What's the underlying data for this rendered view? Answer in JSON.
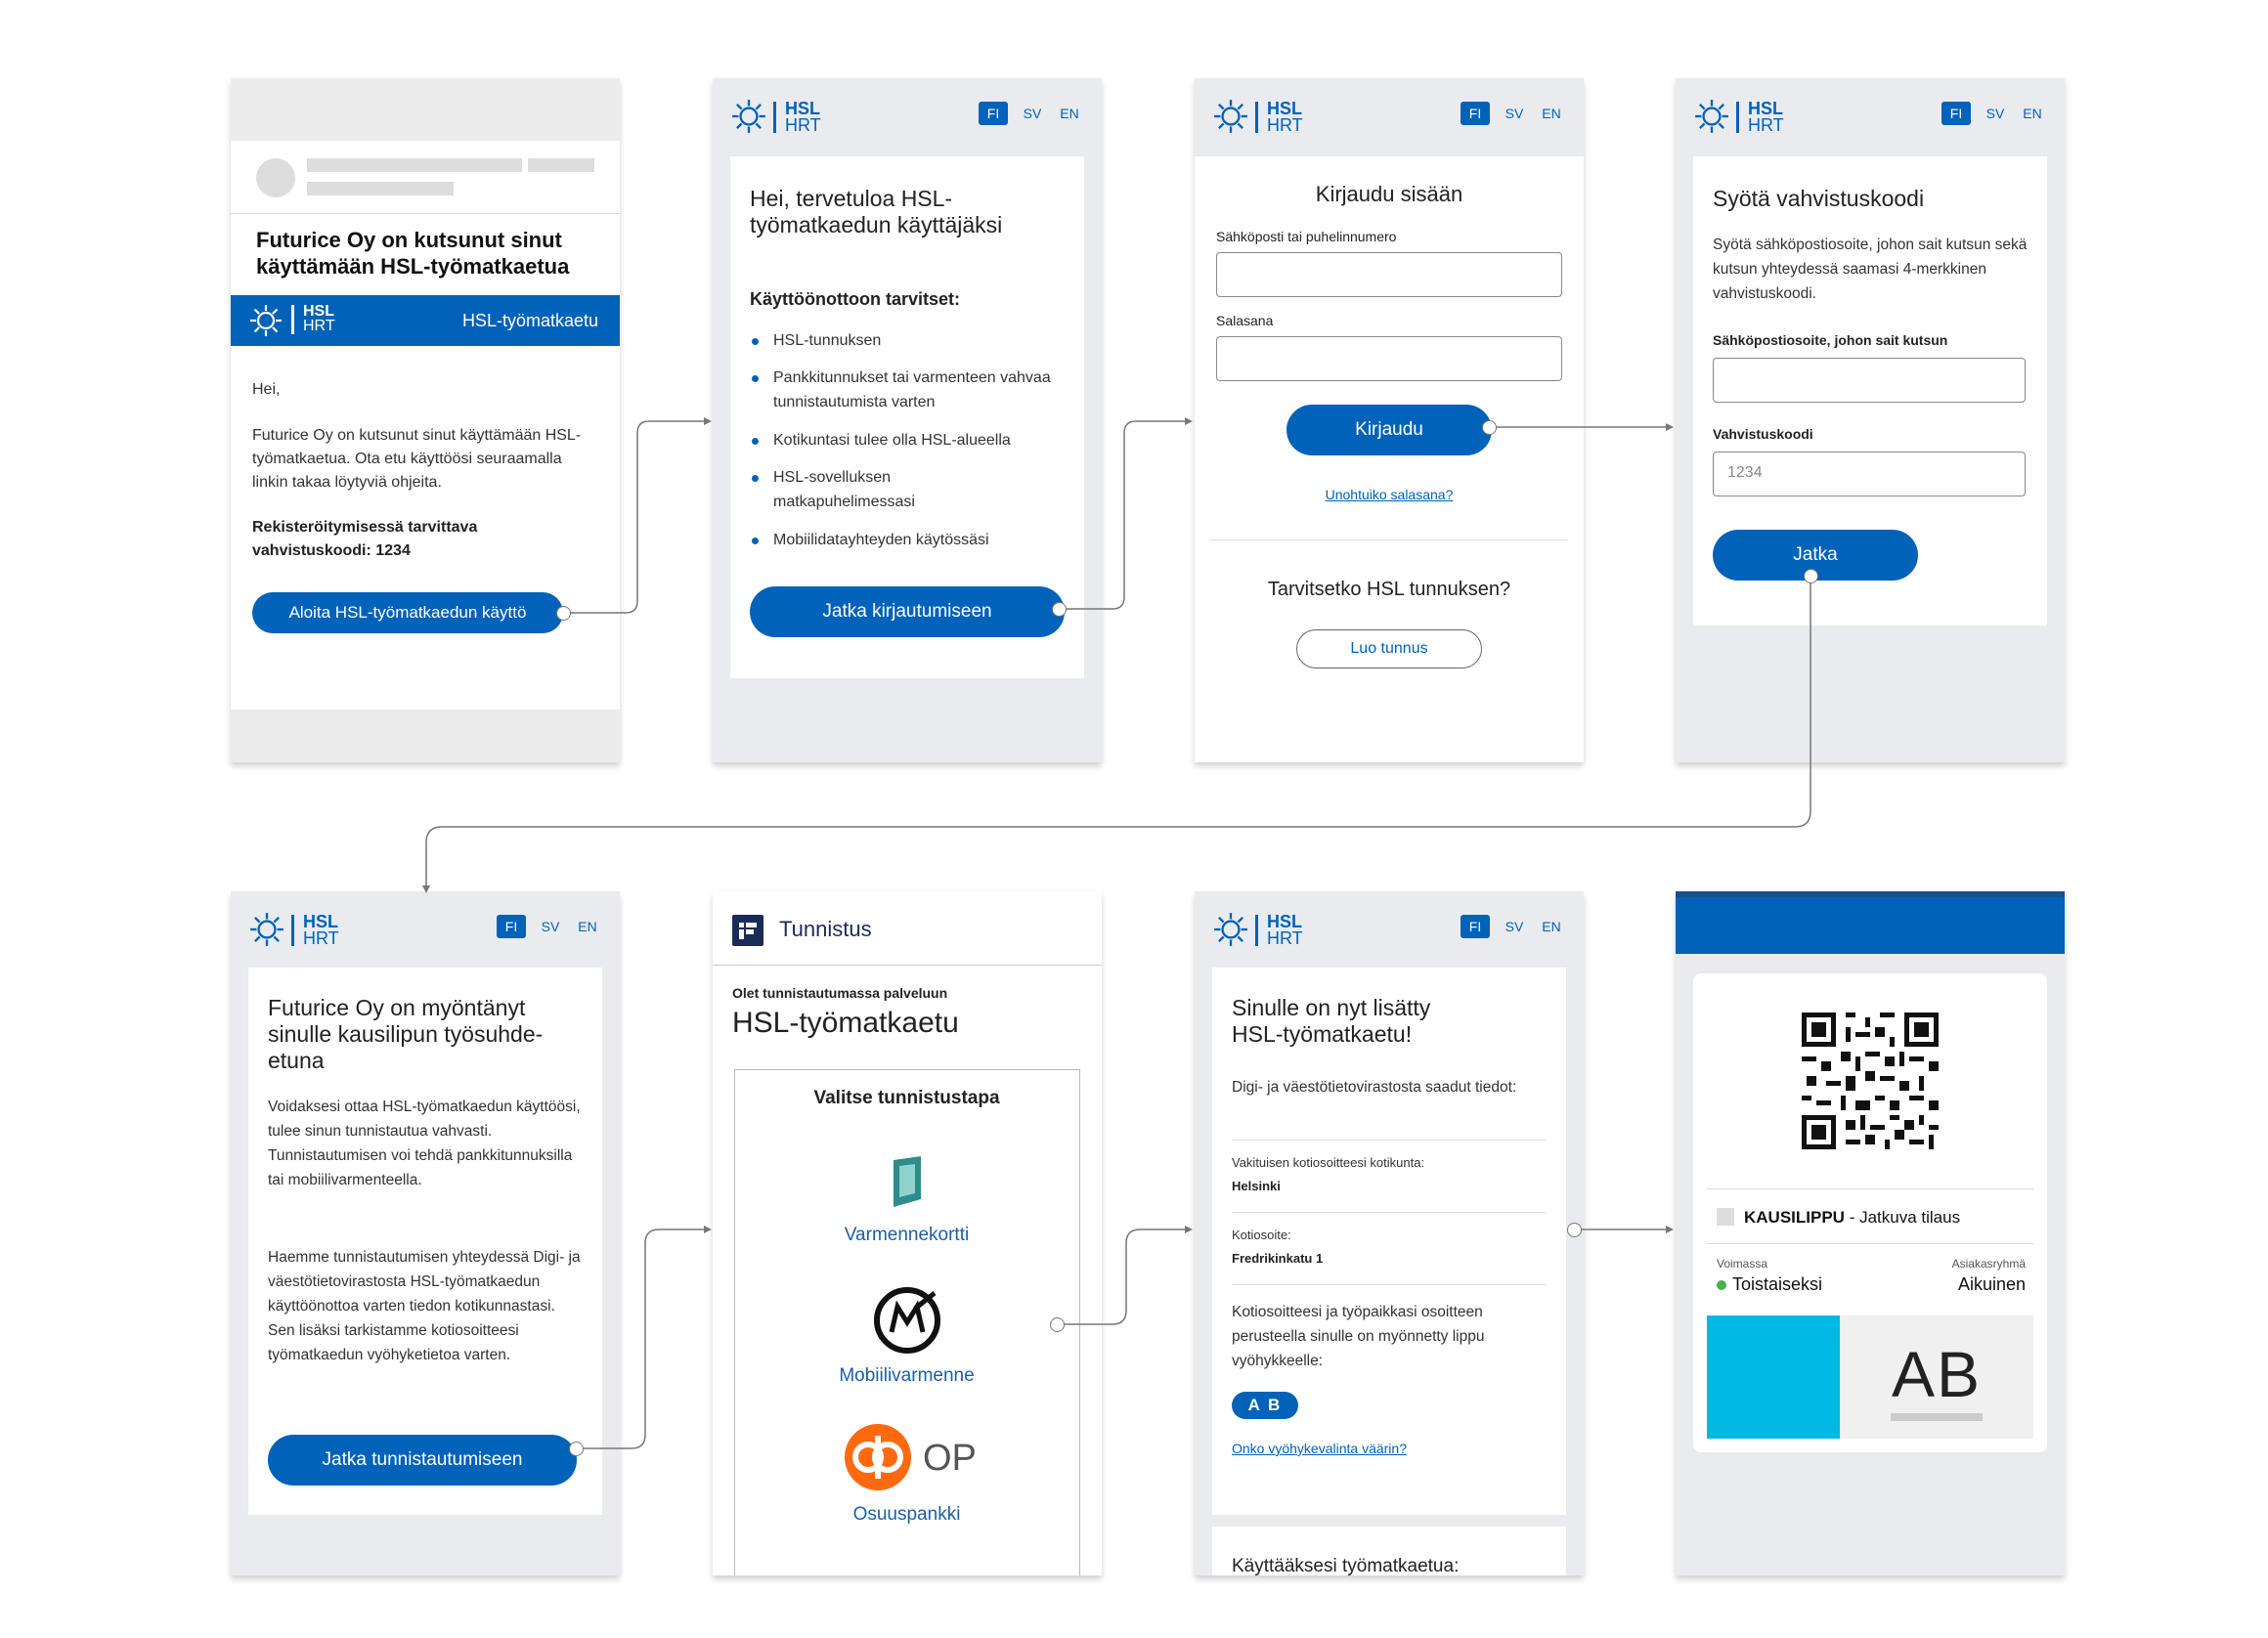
{
  "colors": {
    "brand": "#0062b9",
    "zone": "#00b9e4",
    "green": "#4caf50"
  },
  "lang": {
    "fi": "FI",
    "sv": "SV",
    "en": "EN"
  },
  "logo": {
    "hsl": "HSL",
    "hrt": "HRT"
  },
  "s1": {
    "title": "Futurice Oy on kutsunut sinut käyttämään HSL-työmatkaetua",
    "banner": "HSL-työmatkaetu",
    "greeting": "Hei,",
    "body": "Futurice Oy on kutsunut sinut käyttämään HSL-työmatkaetua. Ota etu käyttöösi seuraamalla linkin takaa löytyviä ohjeita.",
    "code": "Rekisteröitymisessä tarvittava vahvistuskoodi: 1234",
    "button": "Aloita HSL-työmatkaedun käyttö"
  },
  "s2": {
    "title": "Hei, tervetuloa HSL-työmatkaedun käyttäjäksi",
    "subtitle": "Käyttöönottoon tarvitset:",
    "items": [
      "HSL-tunnuksen",
      "Pankkitunnukset tai varmenteen vahvaa tunnistautumista varten",
      "Kotikuntasi tulee olla HSL-alueella",
      "HSL-sovelluksen matkapuhelimessasi",
      "Mobiilidatayhteyden käytössäsi"
    ],
    "button": "Jatka kirjautumiseen"
  },
  "s3": {
    "title": "Kirjaudu sisään",
    "email_label": "Sähköposti tai puhelinnumero",
    "password_label": "Salasana",
    "button": "Kirjaudu",
    "forgot": "Unohtuiko salasana?",
    "need": "Tarvitsetko HSL tunnuksen?",
    "create": "Luo tunnus"
  },
  "s4": {
    "title": "Syötä vahvistuskoodi",
    "body": "Syötä sähköpostiosoite, johon sait kutsun sekä kutsun yhteydessä saamasi 4-merkkinen vahvistuskoodi.",
    "email_label": "Sähköpostiosoite, johon sait kutsun",
    "code_label": "Vahvistuskoodi",
    "code_placeholder": "1234",
    "button": "Jatka"
  },
  "s5": {
    "title": "Futurice Oy on myöntänyt sinulle kausilipun työsuhde-etuna",
    "p1": "Voidaksesi ottaa HSL-työmatkaedun käyttöösi, tulee sinun tunnistautua vahvasti. Tunnistautumisen voi tehdä pankkitunnuksilla tai mobiilivarmenteella.",
    "p2": "Haemme tunnistautumisen yhteydessä Digi- ja väestötietovirastosta HSL-työmatkaedun käyttöönottoa varten tiedon kotikunnastasi. Sen lisäksi tarkistamme kotiosoitteesi työmatkaedun vyöhyketietoa varten.",
    "button": "Jatka tunnistautumiseen"
  },
  "s6": {
    "brand": "Tunnistus",
    "sub": "Olet tunnistautumassa palveluun",
    "service": "HSL-työmatkaetu",
    "choose": "Valitse tunnistustapa",
    "methods": [
      "Varmennekortti",
      "Mobiilivarmenne",
      "Osuuspankki"
    ],
    "op": "OP"
  },
  "s7": {
    "title": "Sinulle on nyt lisätty HSL-työmatkaetu!",
    "intro": "Digi- ja väestötietovirastosta saadut tiedot:",
    "muni_label": "Vakituisen kotiosoitteesi kotikunta:",
    "muni": "Helsinki",
    "addr_label": "Kotiosoite:",
    "addr": "Fredrikinkatu 1",
    "zone_text": "Kotiosoitteesi ja työpaikkasi osoitteen perusteella sinulle on myönnetty lippu vyöhykkeelle:",
    "zones": "A B",
    "link": "Onko vyöhykevalinta väärin?",
    "bottom": "Käyttääksesi työmatkaetua:"
  },
  "s8": {
    "ticket": "KAUSILIPPU",
    "dash": " - ",
    "type": "Jatkuva tilaus",
    "valid_label": "Voimassa",
    "valid": "Toistaiseksi",
    "group_label": "Asiakasryhmä",
    "group": "Aikuinen",
    "zones": "AB"
  }
}
